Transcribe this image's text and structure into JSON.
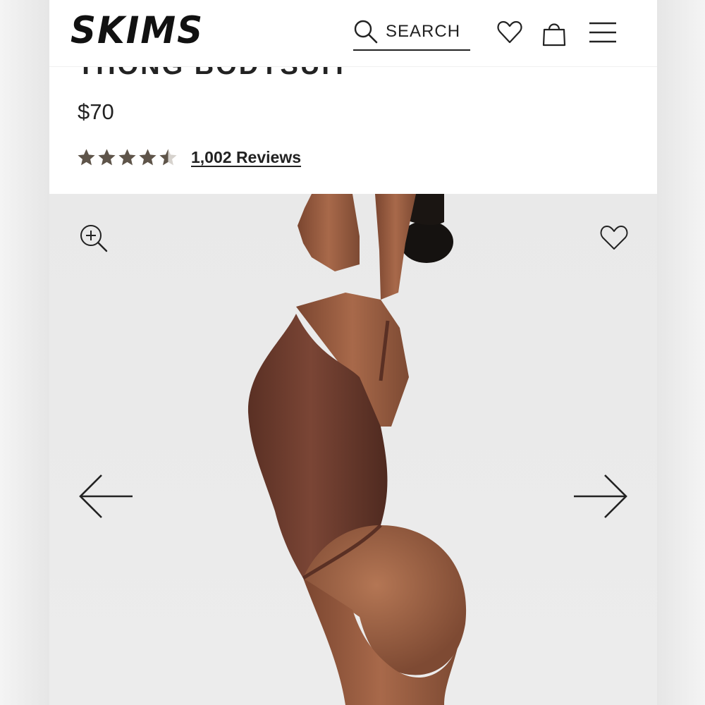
{
  "header": {
    "logo": "SKIMS",
    "search_label": "SEARCH",
    "icons": [
      "search-icon",
      "heart-icon",
      "bag-icon",
      "menu-icon"
    ]
  },
  "product": {
    "title": "THONG BODYSUIT",
    "price": "$70",
    "rating": 4.5,
    "rating_max": 5,
    "reviews_label": "1,002 Reviews"
  },
  "gallery": {
    "controls": [
      "zoom-in-icon",
      "wishlist-heart-icon",
      "arrow-left-icon",
      "arrow-right-icon"
    ]
  },
  "colors": {
    "star": "#5e5449",
    "bodysuit": "#6a3a2c",
    "skin": "#9a5f43",
    "background": "#ececec"
  }
}
